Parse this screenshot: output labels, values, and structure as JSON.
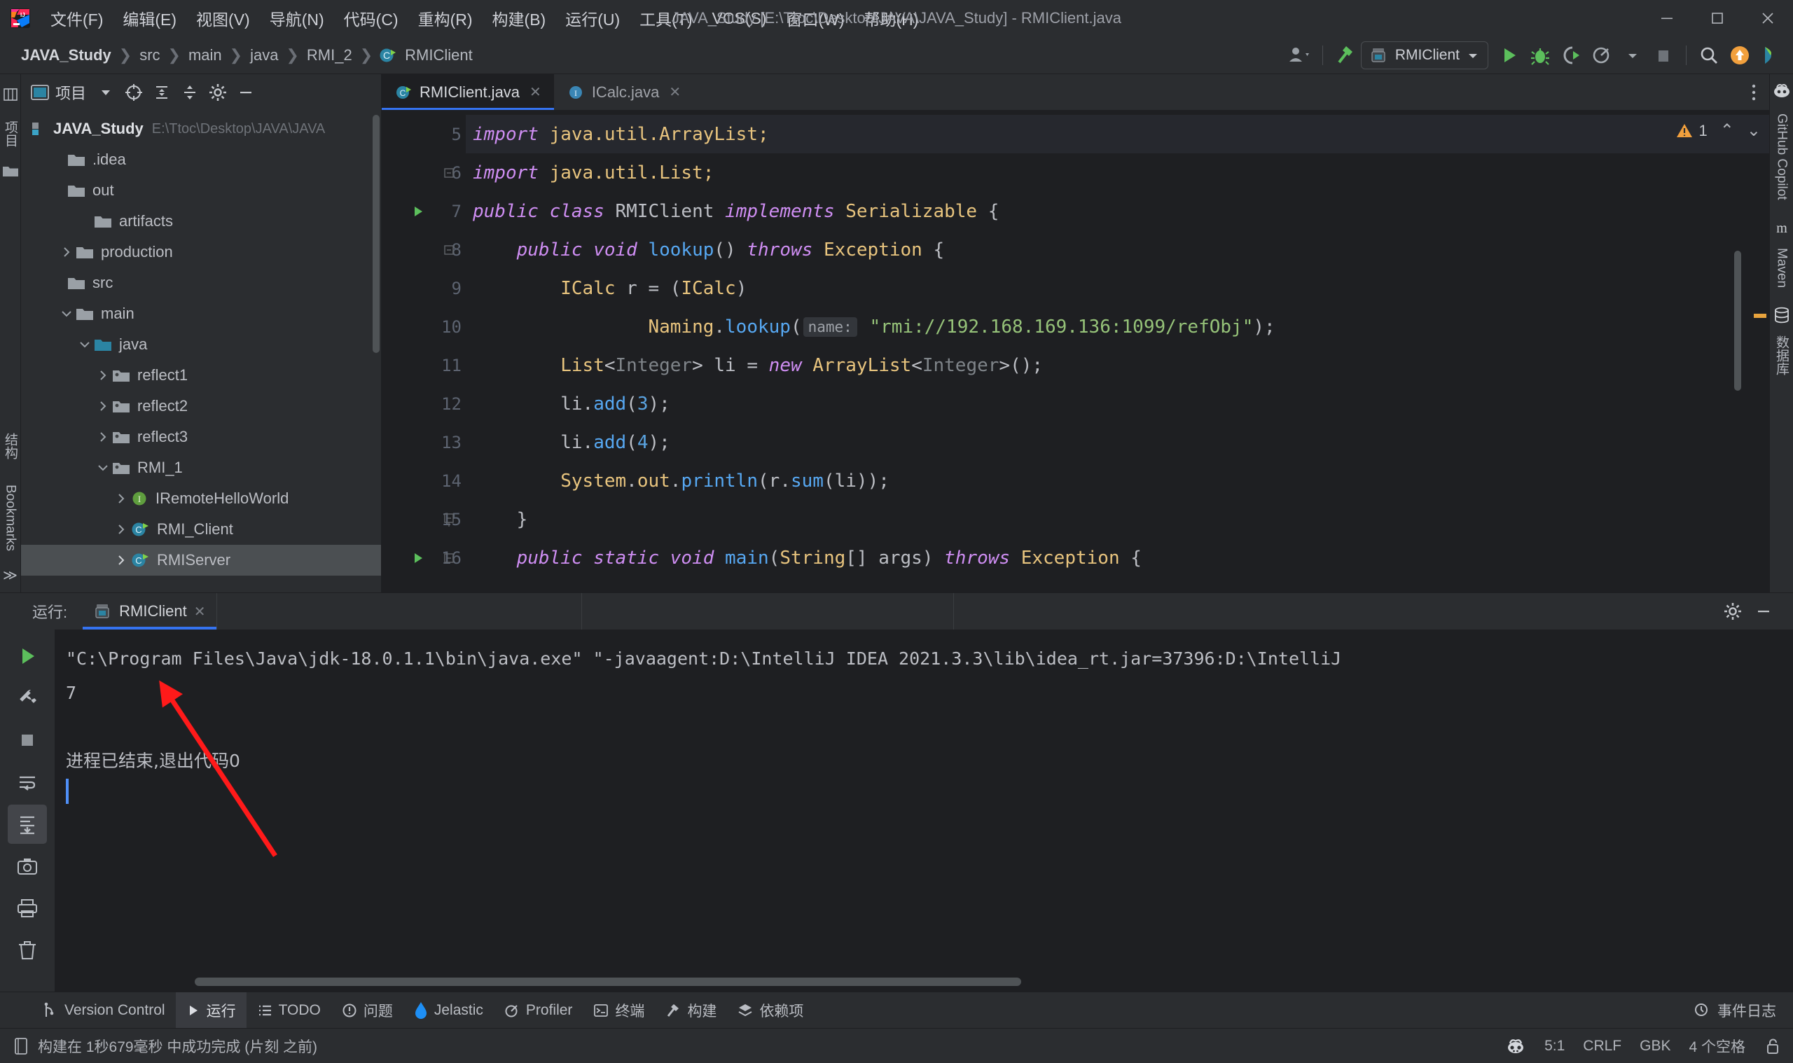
{
  "window": {
    "title": "JAVA_Study [E:\\Ttoc\\Desktop\\JAVA\\JAVA_Study] - RMIClient.java",
    "minimize_icon": "minimize-icon",
    "maximize_icon": "maximize-icon",
    "close_icon": "close-icon"
  },
  "menubar": {
    "logo": "intellij-idea-logo",
    "items": [
      {
        "label": "文件(F)",
        "name": "menu-file"
      },
      {
        "label": "编辑(E)",
        "name": "menu-edit"
      },
      {
        "label": "视图(V)",
        "name": "menu-view"
      },
      {
        "label": "导航(N)",
        "name": "menu-navigate"
      },
      {
        "label": "代码(C)",
        "name": "menu-code"
      },
      {
        "label": "重构(R)",
        "name": "menu-refactor"
      },
      {
        "label": "构建(B)",
        "name": "menu-build"
      },
      {
        "label": "运行(U)",
        "name": "menu-run"
      },
      {
        "label": "工具(T)",
        "name": "menu-tools"
      },
      {
        "label": "VCS(S)",
        "name": "menu-vcs"
      },
      {
        "label": "窗口(W)",
        "name": "menu-window"
      },
      {
        "label": "帮助(H)",
        "name": "menu-help"
      }
    ]
  },
  "navbar": {
    "crumbs": [
      {
        "label": "JAVA_Study",
        "type": "project"
      },
      {
        "label": "src",
        "type": "folder"
      },
      {
        "label": "main",
        "type": "folder"
      },
      {
        "label": "java",
        "type": "folder"
      },
      {
        "label": "RMI_2",
        "type": "folder"
      },
      {
        "label": "RMIClient",
        "type": "class"
      }
    ],
    "separator": "❯",
    "run_config": "RMIClient",
    "icons": {
      "account": "user-account-icon",
      "build": "build-hammer-icon",
      "run": "run-icon",
      "debug": "debug-icon",
      "run_coverage": "run-with-coverage-icon",
      "profiler": "profiler-icon",
      "stop": "stop-icon",
      "search": "search-everywhere-icon",
      "updates": "updates-available-icon",
      "ide_assistant": "ide-assistant-icon"
    }
  },
  "project_panel": {
    "title": "项目",
    "icons": {
      "panel": "project-panel-icon",
      "dropdown": "chevron-down-icon",
      "locate": "select-opened-file-icon",
      "expand_all": "expand-all-icon",
      "collapse_all": "collapse-all-icon",
      "settings": "gear-icon",
      "hide": "hide-panel-icon"
    },
    "tree": [
      {
        "label": "JAVA_Study",
        "path": "E:\\Ttoc\\Desktop\\JAVA\\JAVA",
        "indent": 0,
        "twisty": "",
        "icon": "module-icon",
        "bold": true
      },
      {
        "label": ".idea",
        "indent": 1,
        "twisty": "",
        "icon": "folder-icon"
      },
      {
        "label": "out",
        "indent": 1,
        "twisty": "",
        "icon": "folder-icon"
      },
      {
        "label": "artifacts",
        "indent": 2,
        "twisty": "",
        "icon": "folder-icon"
      },
      {
        "label": "production",
        "indent": 2,
        "twisty": "collapsed",
        "icon": "folder-icon"
      },
      {
        "label": "src",
        "indent": 1,
        "twisty": "",
        "icon": "folder-icon"
      },
      {
        "label": "main",
        "indent": 2,
        "twisty": "expanded",
        "icon": "folder-icon"
      },
      {
        "label": "java",
        "indent": 3,
        "twisty": "expanded",
        "icon": "source-root-icon"
      },
      {
        "label": "reflect1",
        "indent": 4,
        "twisty": "collapsed",
        "icon": "package-icon"
      },
      {
        "label": "reflect2",
        "indent": 4,
        "twisty": "collapsed",
        "icon": "package-icon"
      },
      {
        "label": "reflect3",
        "indent": 4,
        "twisty": "collapsed",
        "icon": "package-icon"
      },
      {
        "label": "RMI_1",
        "indent": 4,
        "twisty": "expanded",
        "icon": "package-icon"
      },
      {
        "label": "IRemoteHelloWorld",
        "indent": 5,
        "twisty": "collapsed",
        "icon": "interface-icon"
      },
      {
        "label": "RMI_Client",
        "indent": 5,
        "twisty": "collapsed",
        "icon": "runnable-class-icon"
      },
      {
        "label": "RMIServer",
        "indent": 5,
        "twisty": "collapsed",
        "icon": "runnable-class-icon",
        "selected": true
      }
    ]
  },
  "left_strip": {
    "top_label": "项目",
    "bottom_labels": [
      "结构",
      "Bookmarks"
    ],
    "more": "≫"
  },
  "right_strip": {
    "items": [
      "GitHub Copilot",
      "Maven",
      "数据库"
    ]
  },
  "editor": {
    "tabs": [
      {
        "label": "RMIClient.java",
        "icon": "java-class-icon",
        "active": true,
        "close": "✕"
      },
      {
        "label": "ICalc.java",
        "icon": "java-interface-icon",
        "active": false,
        "close": "✕"
      }
    ],
    "more_icon": "more-vertical-icon",
    "inspection": {
      "count": "1",
      "icon": "warning-icon",
      "up": "⌃",
      "down": "⌄"
    },
    "lines": [
      {
        "num": "5",
        "marker": "",
        "fold": "",
        "highlight": true,
        "tokens": [
          {
            "t": "import ",
            "c": "kw"
          },
          {
            "t": "java.util.ArrayList;",
            "c": "id"
          }
        ]
      },
      {
        "num": "6",
        "marker": "",
        "fold": "fold-start",
        "tokens": [
          {
            "t": "import ",
            "c": "kw"
          },
          {
            "t": "java.util.List;",
            "c": "id"
          }
        ]
      },
      {
        "num": "7",
        "marker": "run",
        "fold": "",
        "tokens": [
          {
            "t": "public class ",
            "c": "kw"
          },
          {
            "t": "RMIClient ",
            "c": "pl"
          },
          {
            "t": "implements ",
            "c": "kw"
          },
          {
            "t": "Serializable",
            "c": "id"
          },
          {
            "t": " {",
            "c": "pl"
          }
        ]
      },
      {
        "num": "8",
        "marker": "",
        "fold": "fold-start",
        "tokens": [
          {
            "t": "    ",
            "c": "pl"
          },
          {
            "t": "public void ",
            "c": "kw"
          },
          {
            "t": "lookup",
            "c": "mth"
          },
          {
            "t": "() ",
            "c": "pl"
          },
          {
            "t": "throws ",
            "c": "kw"
          },
          {
            "t": "Exception",
            "c": "id"
          },
          {
            "t": " {",
            "c": "pl"
          }
        ]
      },
      {
        "num": "9",
        "marker": "",
        "fold": "",
        "tokens": [
          {
            "t": "        ",
            "c": "pl"
          },
          {
            "t": "ICalc",
            "c": "id"
          },
          {
            "t": " r = (",
            "c": "pl"
          },
          {
            "t": "ICalc",
            "c": "id"
          },
          {
            "t": ")",
            "c": "pl"
          }
        ]
      },
      {
        "num": "10",
        "marker": "",
        "fold": "",
        "tokens": [
          {
            "t": "                ",
            "c": "pl"
          },
          {
            "t": "Naming",
            "c": "id"
          },
          {
            "t": ".",
            "c": "pl"
          },
          {
            "t": "lookup",
            "c": "mth"
          },
          {
            "t": "(",
            "c": "pl"
          },
          {
            "t": "name:",
            "c": "hint"
          },
          {
            "t": " ",
            "c": "pl"
          },
          {
            "t": "\"rmi://192.168.169.136:1099/refObj\"",
            "c": "str"
          },
          {
            "t": ");",
            "c": "pl"
          }
        ]
      },
      {
        "num": "11",
        "marker": "",
        "fold": "",
        "tokens": [
          {
            "t": "        ",
            "c": "pl"
          },
          {
            "t": "List",
            "c": "id"
          },
          {
            "t": "<",
            "c": "pl"
          },
          {
            "t": "Integer",
            "c": "dim"
          },
          {
            "t": "> li = ",
            "c": "pl"
          },
          {
            "t": "new ",
            "c": "kw"
          },
          {
            "t": "ArrayList",
            "c": "id"
          },
          {
            "t": "<",
            "c": "pl"
          },
          {
            "t": "Integer",
            "c": "dim"
          },
          {
            "t": ">();",
            "c": "pl"
          }
        ]
      },
      {
        "num": "12",
        "marker": "",
        "fold": "",
        "tokens": [
          {
            "t": "        ",
            "c": "pl"
          },
          {
            "t": "li.",
            "c": "pl"
          },
          {
            "t": "add",
            "c": "mth"
          },
          {
            "t": "(",
            "c": "pl"
          },
          {
            "t": "3",
            "c": "num"
          },
          {
            "t": ");",
            "c": "pl"
          }
        ]
      },
      {
        "num": "13",
        "marker": "",
        "fold": "",
        "tokens": [
          {
            "t": "        ",
            "c": "pl"
          },
          {
            "t": "li.",
            "c": "pl"
          },
          {
            "t": "add",
            "c": "mth"
          },
          {
            "t": "(",
            "c": "pl"
          },
          {
            "t": "4",
            "c": "num"
          },
          {
            "t": ");",
            "c": "pl"
          }
        ]
      },
      {
        "num": "14",
        "marker": "",
        "fold": "",
        "tokens": [
          {
            "t": "        ",
            "c": "pl"
          },
          {
            "t": "System",
            "c": "id"
          },
          {
            "t": ".",
            "c": "pl"
          },
          {
            "t": "out",
            "c": "id"
          },
          {
            "t": ".",
            "c": "pl"
          },
          {
            "t": "println",
            "c": "mth"
          },
          {
            "t": "(r.",
            "c": "pl"
          },
          {
            "t": "sum",
            "c": "mth"
          },
          {
            "t": "(li));",
            "c": "pl"
          }
        ]
      },
      {
        "num": "15",
        "marker": "",
        "fold": "fold-end",
        "tokens": [
          {
            "t": "    }",
            "c": "pl"
          }
        ]
      },
      {
        "num": "16",
        "marker": "run",
        "fold": "fold-start",
        "tokens": [
          {
            "t": "    ",
            "c": "pl"
          },
          {
            "t": "public static void ",
            "c": "kw"
          },
          {
            "t": "main",
            "c": "mth"
          },
          {
            "t": "(",
            "c": "pl"
          },
          {
            "t": "String",
            "c": "id"
          },
          {
            "t": "[] args) ",
            "c": "pl"
          },
          {
            "t": "throws ",
            "c": "kw"
          },
          {
            "t": "Exception",
            "c": "id"
          },
          {
            "t": " {",
            "c": "pl"
          }
        ]
      }
    ]
  },
  "run_window": {
    "title": "运行:",
    "tab": "RMIClient",
    "tab_icon": "run-config-icon",
    "tab_close": "✕",
    "settings_icon": "gear-icon",
    "hide_icon": "hide-icon",
    "gutter_buttons": [
      {
        "name": "rerun-button",
        "icon": "run-green-icon"
      },
      {
        "name": "wrench-button",
        "icon": "wrench-icon"
      },
      {
        "name": "stop-button",
        "icon": "stop-square-icon"
      },
      {
        "name": "soft-wrap-button",
        "icon": "soft-wrap-icon"
      },
      {
        "name": "scroll-to-end-button",
        "icon": "scroll-to-end-icon",
        "active": true
      },
      {
        "name": "up-button",
        "icon": "arrow-up-icon"
      },
      {
        "name": "down-button",
        "icon": "arrow-down-icon"
      },
      {
        "name": "print-button",
        "icon": "print-icon"
      },
      {
        "name": "camera-button",
        "icon": "camera-icon"
      },
      {
        "name": "clear-button",
        "icon": "trash-icon"
      }
    ],
    "console": [
      "\"C:\\Program Files\\Java\\jdk-18.0.1.1\\bin\\java.exe\" \"-javaagent:D:\\IntelliJ IDEA 2021.3.3\\lib\\idea_rt.jar=37396:D:\\IntelliJ",
      "7",
      "",
      "进程已结束,退出代码0"
    ]
  },
  "annotation": {
    "color": "#FF1A1A",
    "shape": "arrow",
    "points_at": "console-output-7"
  },
  "bottom_bar": {
    "items": [
      {
        "label": "Version Control",
        "icon": "vcs-icon",
        "active": false
      },
      {
        "label": "运行",
        "icon": "run-triangle-icon",
        "active": true
      },
      {
        "label": "TODO",
        "icon": "todo-list-icon",
        "active": false
      },
      {
        "label": "问题",
        "icon": "problems-icon",
        "active": false
      },
      {
        "label": "Jelastic",
        "icon": "jelastic-icon",
        "active": false
      },
      {
        "label": "Profiler",
        "icon": "profiler-icon",
        "active": false
      },
      {
        "label": "终端",
        "icon": "terminal-icon",
        "active": false
      },
      {
        "label": "构建",
        "icon": "build-icon",
        "active": false
      },
      {
        "label": "依赖项",
        "icon": "dependencies-icon",
        "active": false
      }
    ],
    "event_log": {
      "label": "事件日志",
      "icon": "event-log-icon"
    }
  },
  "status_bar": {
    "message": "构建在 1秒679毫秒 中成功完成 (片刻 之前)",
    "message_icon": "build-status-icon",
    "right": [
      {
        "label": "",
        "icon": "code-with-me-icon",
        "name": "code-with-me"
      },
      {
        "label": "5:1",
        "name": "caret-position"
      },
      {
        "label": "CRLF",
        "name": "line-separator"
      },
      {
        "label": "GBK",
        "name": "file-encoding"
      },
      {
        "label": "4 个空格",
        "name": "indent-setting"
      },
      {
        "label": "",
        "icon": "lock-open-icon",
        "name": "readonly-toggle"
      }
    ]
  }
}
